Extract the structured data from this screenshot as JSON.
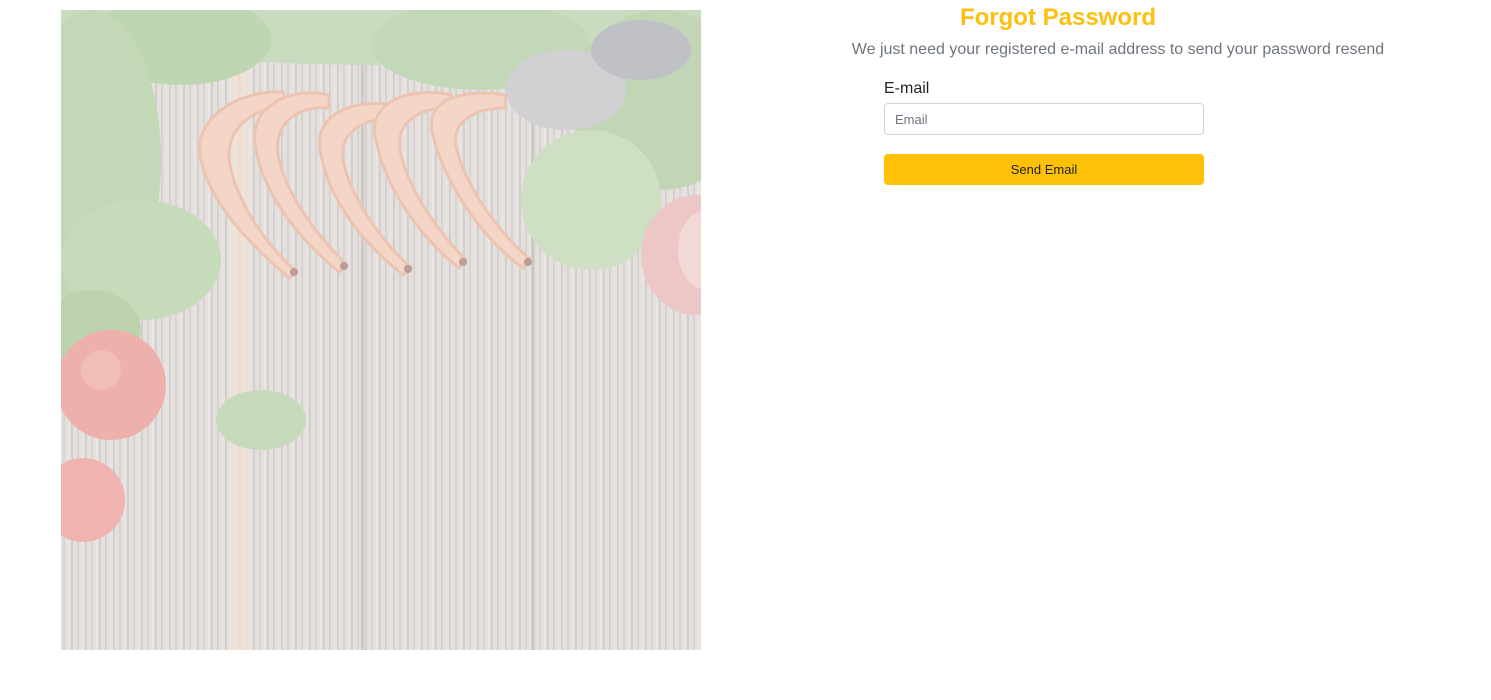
{
  "hero": {
    "image_name": "food-background-image"
  },
  "form": {
    "title": "Forgot Password",
    "subtitle": "We just need your registered e-mail address to send your password resend",
    "email_label": "E-mail",
    "email_placeholder": "Email",
    "email_value": "",
    "submit_label": "Send Email"
  },
  "colors": {
    "accent": "#ffc107",
    "title": "#fdc010",
    "subtitle": "#6e757c"
  }
}
